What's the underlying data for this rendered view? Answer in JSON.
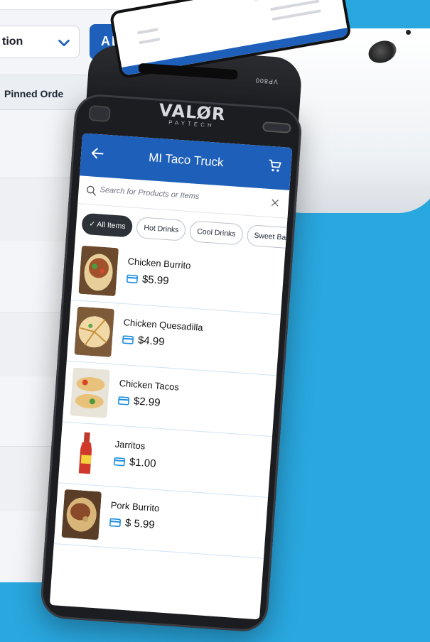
{
  "background_app": {
    "select_label": "tion",
    "add_button_label": "ADD IT",
    "pinned_label": "Pinned Orde"
  },
  "device": {
    "brand_name": "VALØR",
    "brand_sub": "PAYTECH",
    "model": "VP800"
  },
  "app": {
    "store_title": "MI Taco Truck",
    "search_placeholder": "Search for Products or Items",
    "categories": [
      {
        "label": "✓ All Items",
        "active": true
      },
      {
        "label": "Hot Drinks",
        "active": false
      },
      {
        "label": "Cool Drinks",
        "active": false
      },
      {
        "label": "Sweet Bakery",
        "active": false
      }
    ],
    "products": [
      {
        "name": "Chicken Burrito",
        "price": "$5.99"
      },
      {
        "name": "Chicken Quesadilla",
        "price": "$4.99"
      },
      {
        "name": "Chicken Tacos",
        "price": "$2.99"
      },
      {
        "name": "Jarritos",
        "price": "$1.00"
      },
      {
        "name": "Pork Burrito",
        "price": "$ 5.99"
      }
    ]
  },
  "colors": {
    "background": "#29a7df",
    "brand_blue": "#1d5fb9",
    "device_body": "#1c1d21"
  }
}
